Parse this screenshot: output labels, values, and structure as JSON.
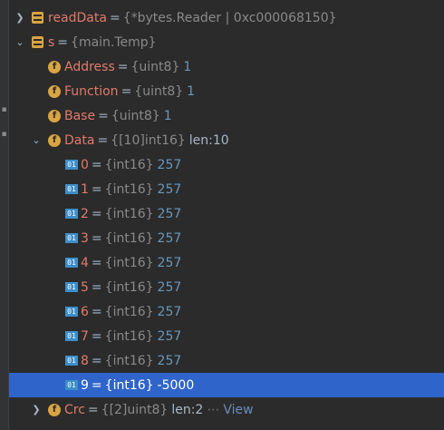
{
  "tree": {
    "readData": {
      "name": "readData",
      "type": "{*bytes.Reader | 0xc000068150}"
    },
    "s": {
      "name": "s",
      "type": "{main.Temp}",
      "fields": [
        {
          "name": "Address",
          "type": "{uint8}",
          "value": "1"
        },
        {
          "name": "Function",
          "type": "{uint8}",
          "value": "1"
        },
        {
          "name": "Base",
          "type": "{uint8}",
          "value": "1"
        }
      ],
      "data": {
        "name": "Data",
        "type": "{[10]int16}",
        "len": "len:10",
        "elements": [
          {
            "index": "0",
            "type": "{int16}",
            "value": "257"
          },
          {
            "index": "1",
            "type": "{int16}",
            "value": "257"
          },
          {
            "index": "2",
            "type": "{int16}",
            "value": "257"
          },
          {
            "index": "3",
            "type": "{int16}",
            "value": "257"
          },
          {
            "index": "4",
            "type": "{int16}",
            "value": "257"
          },
          {
            "index": "5",
            "type": "{int16}",
            "value": "257"
          },
          {
            "index": "6",
            "type": "{int16}",
            "value": "257"
          },
          {
            "index": "7",
            "type": "{int16}",
            "value": "257"
          },
          {
            "index": "8",
            "type": "{int16}",
            "value": "257"
          },
          {
            "index": "9",
            "type": "{int16}",
            "value": "-5000"
          }
        ]
      },
      "crc": {
        "name": "Crc",
        "type": "{[2]uint8}",
        "len": "len:2",
        "ellipsis": "⋯",
        "view": "View"
      }
    }
  },
  "icons": {
    "variable": "variable-icon",
    "field": "field-icon",
    "element": "array-element-icon"
  },
  "colors": {
    "selection": "#2f65ca",
    "name": "#e07a6a",
    "value": "#6897bb",
    "type": "#8a8a8a"
  }
}
